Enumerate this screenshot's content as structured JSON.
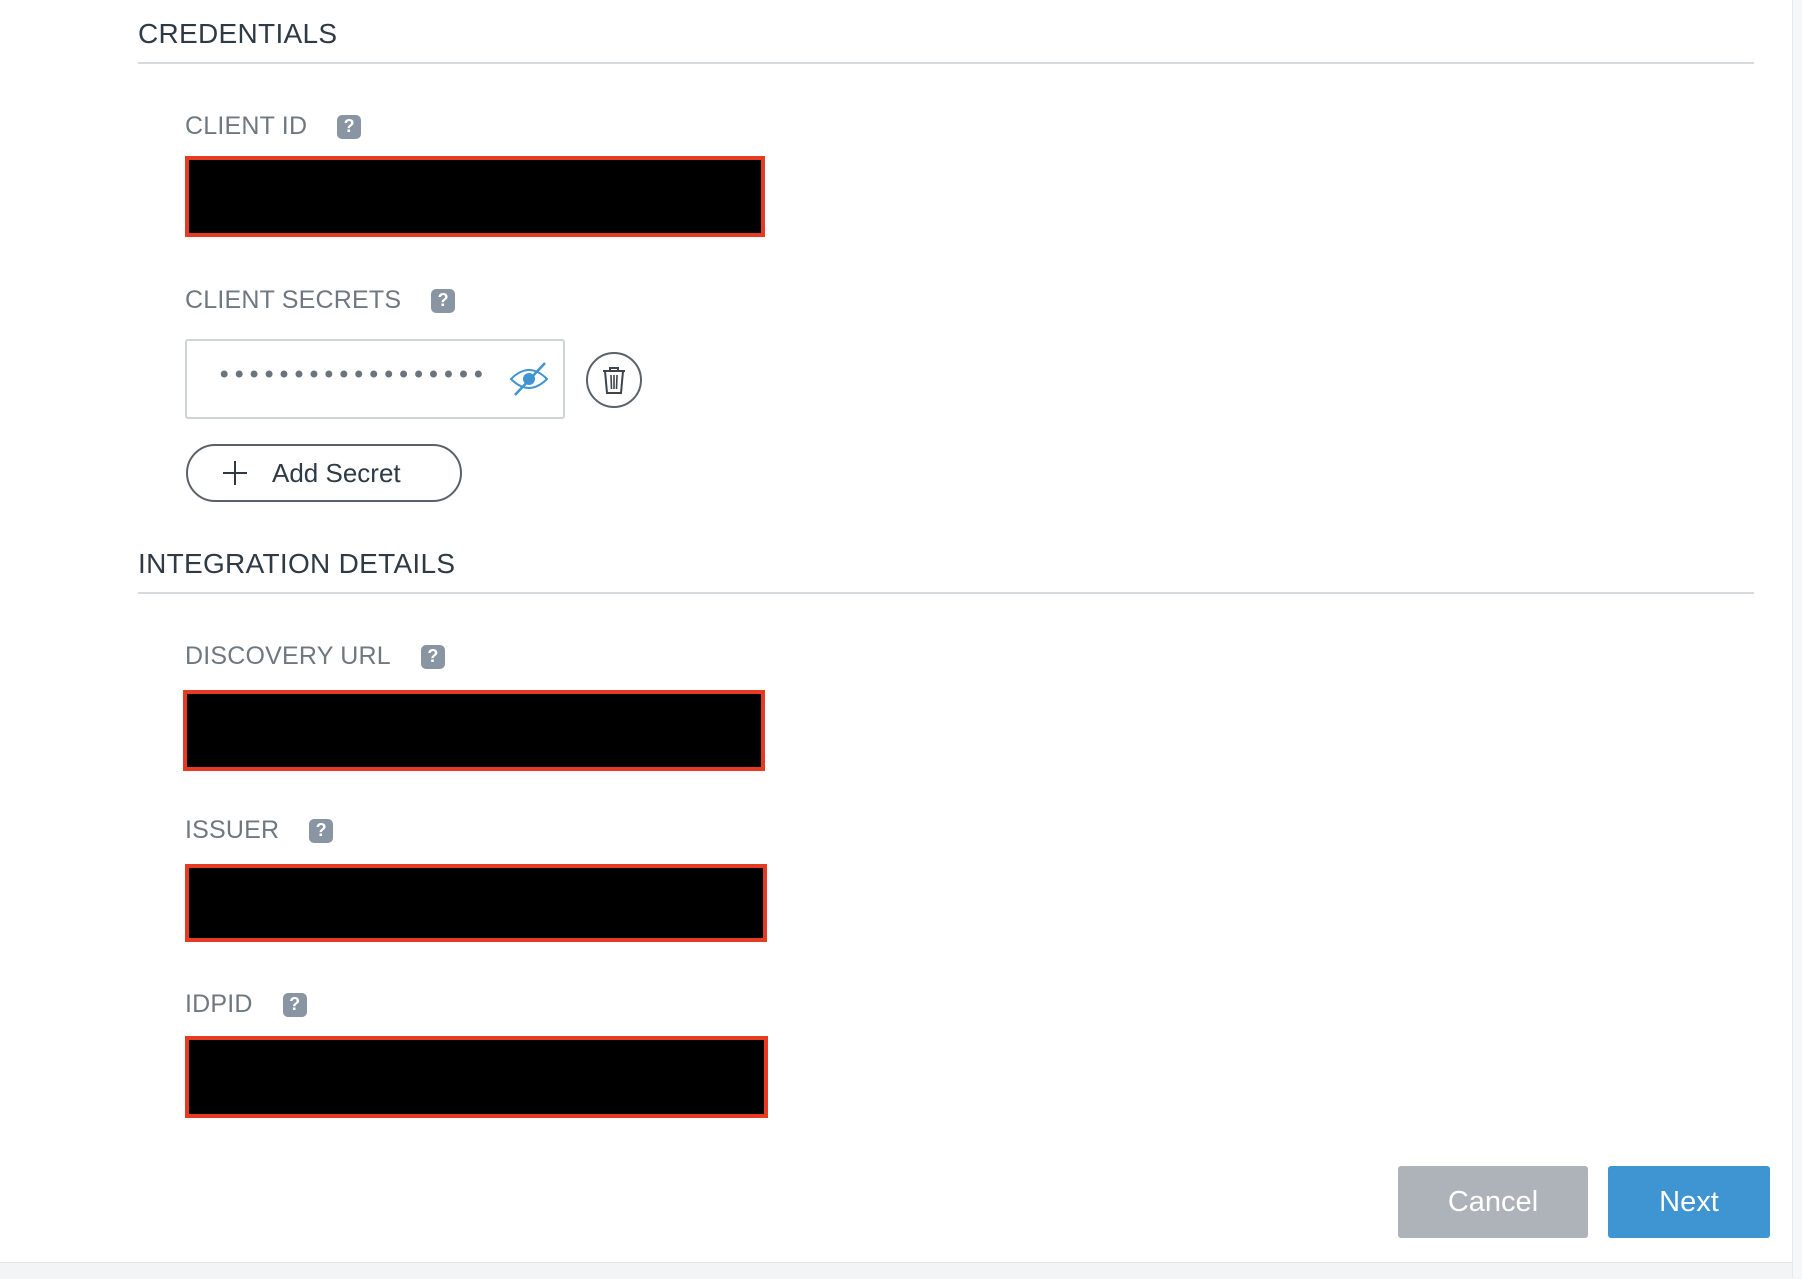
{
  "credentials": {
    "title": "CREDENTIALS",
    "client_id": {
      "label": "CLIENT ID",
      "help": "?"
    },
    "client_secrets": {
      "label": "CLIENT SECRETS",
      "help": "?",
      "masked_value": "••••••••••••••••••••••••••••",
      "add_label": "Add Secret"
    }
  },
  "integration": {
    "title": "INTEGRATION DETAILS",
    "discovery_url": {
      "label": "DISCOVERY URL",
      "help": "?"
    },
    "issuer": {
      "label": "ISSUER",
      "help": "?"
    },
    "idpid": {
      "label": "IDPID",
      "help": "?"
    }
  },
  "footer": {
    "cancel_label": "Cancel",
    "next_label": "Next"
  },
  "colors": {
    "primary": "#3f95d1",
    "secondary": "#aeb3b9",
    "redaction_border": "#e43b22",
    "help_icon": "#8a95a3"
  },
  "icons": {
    "help": "question-mark-icon",
    "visibility": "eye-slash-icon",
    "delete": "trash-icon",
    "add": "plus-icon"
  }
}
